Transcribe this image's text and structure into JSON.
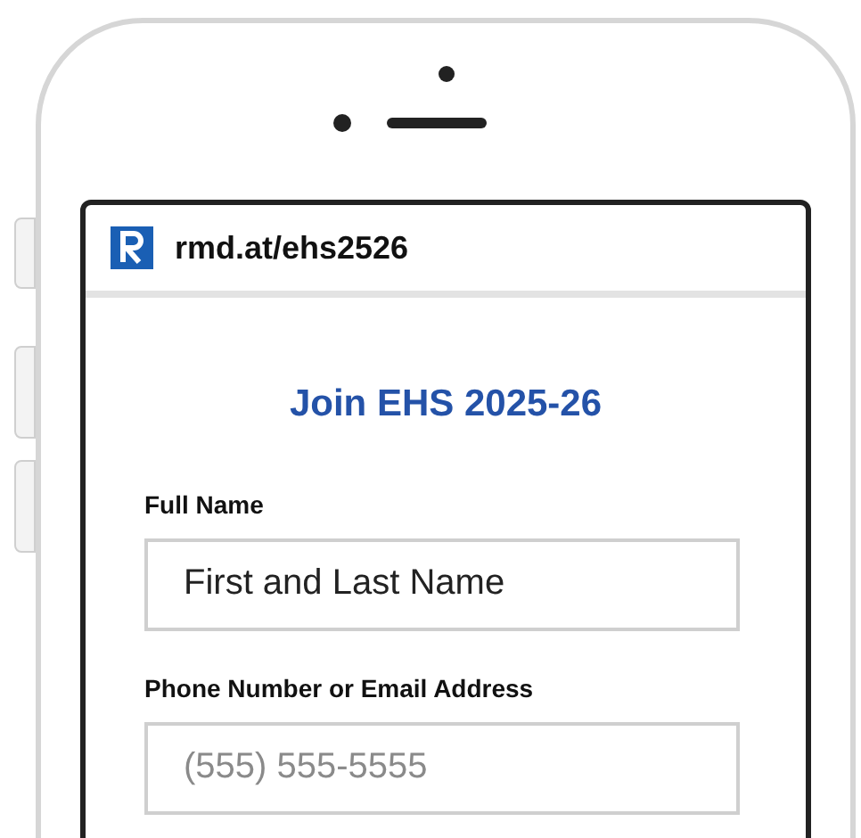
{
  "browser": {
    "url": "rmd.at/ehs2526"
  },
  "form": {
    "title": "Join EHS 2025-26",
    "fields": [
      {
        "label": "Full Name",
        "value": "First and Last Name"
      },
      {
        "label": "Phone Number or Email Address",
        "placeholder": "(555) 555-5555"
      }
    ]
  }
}
